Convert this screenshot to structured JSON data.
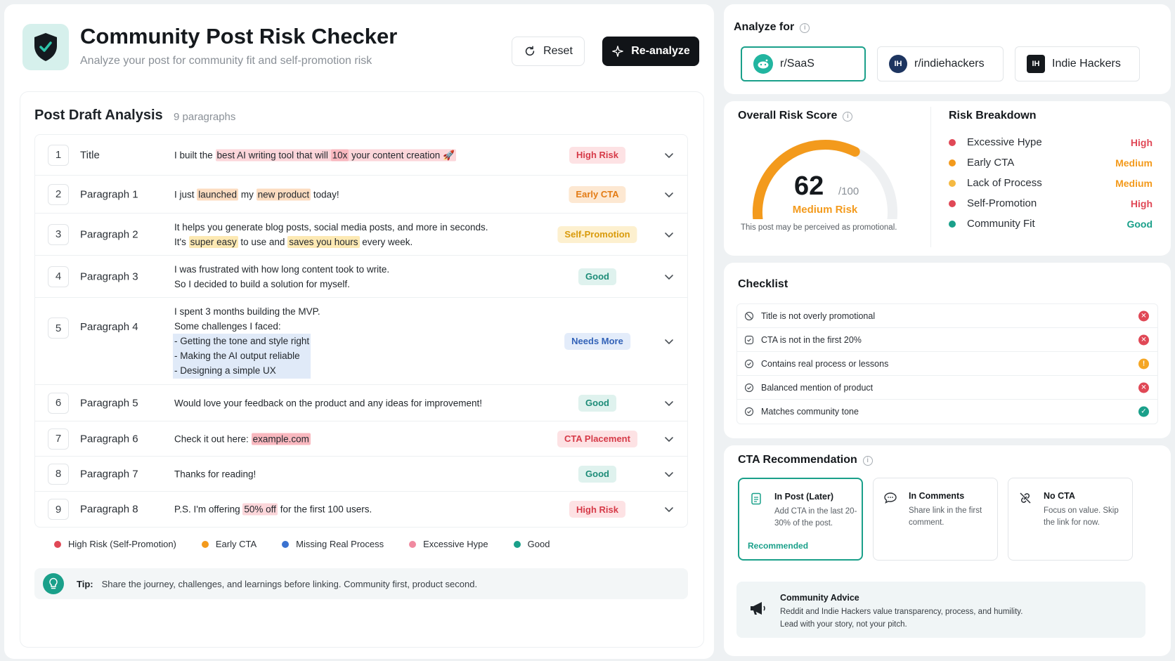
{
  "header": {
    "title": "Community Post Risk Checker",
    "subtitle": "Analyze your post for community fit and self-promotion risk",
    "reset_label": "Reset",
    "reanalyze_label": "Re-analyze"
  },
  "draft": {
    "title": "Post Draft Analysis",
    "count": "9 paragraphs",
    "rows": [
      {
        "num": "1",
        "label": "Title",
        "badge": "High Risk"
      },
      {
        "num": "2",
        "label": "Paragraph 1",
        "badge": "Early CTA"
      },
      {
        "num": "3",
        "label": "Paragraph 2",
        "badge": "Self-Promotion"
      },
      {
        "num": "4",
        "label": "Paragraph 3",
        "badge": "Good"
      },
      {
        "num": "5",
        "label": "Paragraph 4",
        "badge": "Needs More"
      },
      {
        "num": "6",
        "label": "Paragraph 5",
        "badge": "Good"
      },
      {
        "num": "7",
        "label": "Paragraph 6",
        "badge": "CTA Placement"
      },
      {
        "num": "8",
        "label": "Paragraph 7",
        "badge": "Good"
      },
      {
        "num": "9",
        "label": "Paragraph 8",
        "badge": "High Risk"
      }
    ],
    "text": {
      "r1": [
        "I built the ",
        "best AI writing tool that will ",
        "10x",
        " your content creation 🚀"
      ],
      "r2": [
        "I just ",
        "launched",
        " my ",
        "new product",
        " today!"
      ],
      "r3": [
        "It helps you generate blog posts, social media posts, and more in seconds.",
        "It's ",
        "super easy",
        " to use and ",
        "saves you hours",
        " every week."
      ],
      "r4": [
        "I was frustrated with how long content took to write.",
        "So I decided to build a solution for myself."
      ],
      "r5": [
        "I spent 3 months building the MVP.",
        "Some challenges I faced:",
        "- Getting the tone and style right",
        "- Making the AI output reliable",
        "- Designing a simple UX"
      ],
      "r6": [
        "Would love your feedback on the product and any ideas for improvement!"
      ],
      "r7": [
        "Check it out here: ",
        "example.com"
      ],
      "r8": [
        "Thanks for reading!"
      ],
      "r9": [
        "P.S. I'm offering ",
        "50% off",
        " for the first 100 users."
      ]
    }
  },
  "legend": [
    {
      "label": "High Risk (Self-Promotion)",
      "color": "#e04856"
    },
    {
      "label": "Early CTA",
      "color": "#f39a1c"
    },
    {
      "label": "Missing Real Process",
      "color": "#3a72d0"
    },
    {
      "label": "Excessive Hype",
      "color": "#f08aa0"
    },
    {
      "label": "Good",
      "color": "#1aa08a"
    }
  ],
  "tip": {
    "label": "Tip:",
    "text": "Share the journey, challenges, and learnings before linking. Community first, product second."
  },
  "analyze": {
    "title": "Analyze for",
    "tabs": [
      {
        "label": "r/SaaS",
        "active": true
      },
      {
        "label": "r/indiehackers",
        "active": false
      },
      {
        "label": "Indie Hackers",
        "active": false
      }
    ],
    "ih_mark": "IH"
  },
  "score": {
    "title": "Overall Risk Score",
    "value": 62,
    "max_label": "/100",
    "level": "Medium Risk",
    "note": "This post may be perceived as promotional.",
    "gauge_color": "#f39a1c",
    "track_color": "#eef0f2"
  },
  "breakdown": {
    "title": "Risk Breakdown",
    "items": [
      {
        "label": "Excessive Hype",
        "value": "High",
        "dot": "#e04856",
        "color": "#e04856"
      },
      {
        "label": "Early CTA",
        "value": "Medium",
        "dot": "#f39a1c",
        "color": "#f39a1c"
      },
      {
        "label": "Lack of Process",
        "value": "Medium",
        "dot": "#f5b942",
        "color": "#f39a1c"
      },
      {
        "label": "Self-Promotion",
        "value": "High",
        "dot": "#e04856",
        "color": "#e04856"
      },
      {
        "label": "Community Fit",
        "value": "Good",
        "dot": "#1aa08a",
        "color": "#1aa08a"
      }
    ]
  },
  "checklist": {
    "title": "Checklist",
    "items": [
      {
        "label": "Title is not overly promotional",
        "status": "fail"
      },
      {
        "label": "CTA is not in the first 20%",
        "status": "fail"
      },
      {
        "label": "Contains real process or lessons",
        "status": "warn"
      },
      {
        "label": "Balanced mention of product",
        "status": "fail"
      },
      {
        "label": "Matches community tone",
        "status": "pass"
      }
    ]
  },
  "cta": {
    "title": "CTA Recommendation",
    "options": [
      {
        "title": "In Post (Later)",
        "desc": "Add CTA in the last 20-30% of the post.",
        "tag": "Recommended"
      },
      {
        "title": "In Comments",
        "desc": "Share link in the first comment."
      },
      {
        "title": "No CTA",
        "desc": "Focus on value. Skip the link for now."
      }
    ]
  },
  "advice": {
    "title": "Community Advice",
    "line1": "Reddit and Indie Hackers value transparency, process, and humility.",
    "line2": "Lead with your story, not your pitch."
  }
}
